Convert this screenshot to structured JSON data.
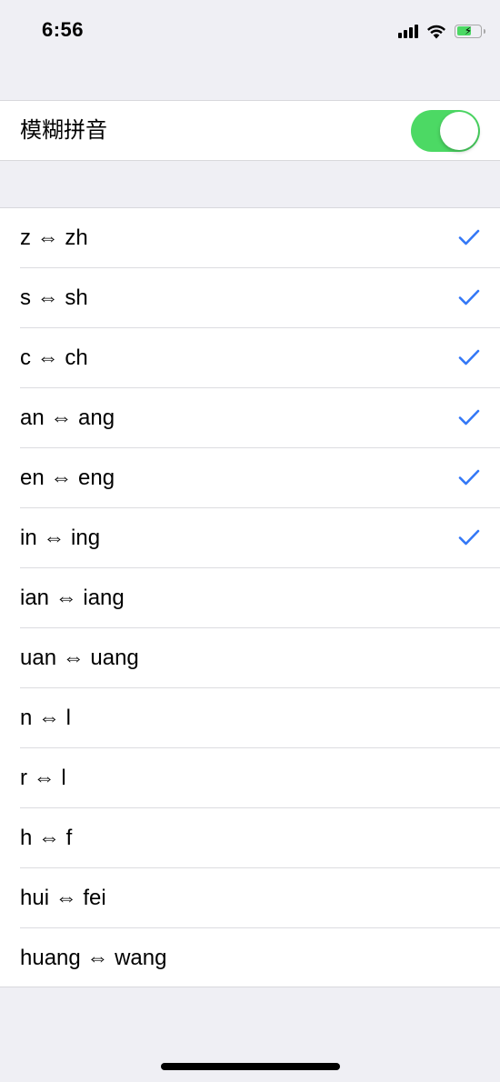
{
  "status_bar": {
    "time": "6:56",
    "icons": [
      "cellular-signal-icon",
      "wifi-icon",
      "battery-charging-icon"
    ],
    "battery_color": "#4cd964"
  },
  "fuzzy_pinyin": {
    "label": "模糊拼音",
    "enabled": true,
    "switch_color": "#4cd964"
  },
  "options": [
    {
      "label": "z ⇔ zh",
      "checked": true
    },
    {
      "label": "s ⇔ sh",
      "checked": true
    },
    {
      "label": "c ⇔ ch",
      "checked": true
    },
    {
      "label": "an ⇔ ang",
      "checked": true
    },
    {
      "label": "en ⇔ eng",
      "checked": true
    },
    {
      "label": "in ⇔ ing",
      "checked": true
    },
    {
      "label": "ian ⇔ iang",
      "checked": false
    },
    {
      "label": "uan ⇔ uang",
      "checked": false
    },
    {
      "label": "n ⇔ l",
      "checked": false
    },
    {
      "label": "r ⇔ l",
      "checked": false
    },
    {
      "label": "h ⇔ f",
      "checked": false
    },
    {
      "label": "hui ⇔ fei",
      "checked": false
    },
    {
      "label": "huang ⇔ wang",
      "checked": false
    }
  ],
  "check_color": "#3478f6"
}
